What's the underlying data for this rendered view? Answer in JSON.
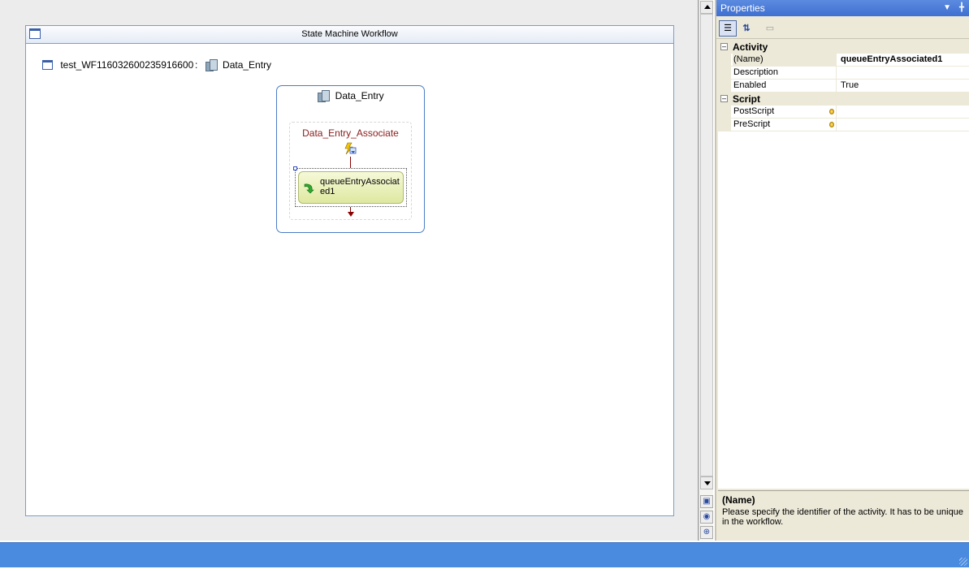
{
  "designer": {
    "workflow_title": "State Machine Workflow",
    "breadcrumb": {
      "workflow_name": "test_WF116032600235916600",
      "separator": ":",
      "state_name": "Data_Entry"
    },
    "state": {
      "title": "Data_Entry",
      "event_driven": {
        "title": "Data_Entry_Associate",
        "activity_label": "queueEntryAssociated1"
      }
    }
  },
  "properties": {
    "title": "Properties",
    "categories": [
      {
        "name": "Activity",
        "rows": [
          {
            "name": "(Name)",
            "value": "queueEntryAssociated1"
          },
          {
            "name": "Description",
            "value": ""
          },
          {
            "name": "Enabled",
            "value": "True"
          }
        ]
      },
      {
        "name": "Script",
        "rows": [
          {
            "name": "PostScript",
            "value": ""
          },
          {
            "name": "PreScript",
            "value": ""
          }
        ]
      }
    ],
    "description": {
      "title": "(Name)",
      "text": "Please specify the identifier of the activity. It has to be unique in the workflow."
    }
  },
  "colors": {
    "statusbar": "#4a8be0",
    "titlebar": "#3f6fd0",
    "event_title": "#8b1a1a",
    "activity_fill": "#dfe8a0"
  }
}
